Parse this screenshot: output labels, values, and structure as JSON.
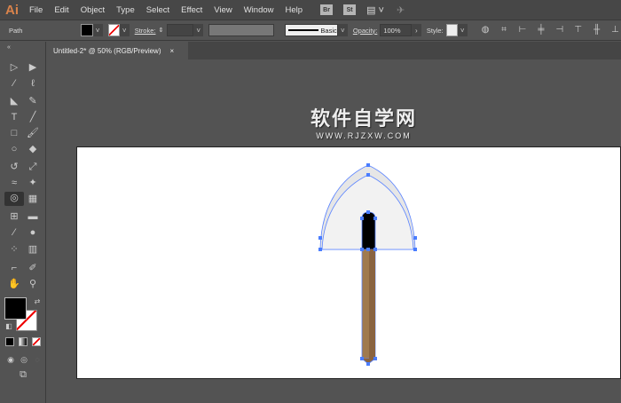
{
  "app": {
    "logo": "Ai"
  },
  "menu": [
    "File",
    "Edit",
    "Object",
    "Type",
    "Select",
    "Effect",
    "View",
    "Window",
    "Help"
  ],
  "bridge": [
    "Br",
    "St"
  ],
  "control": {
    "selection": "Path",
    "stroke_label": "Stroke:",
    "brush": "Basic",
    "opacity_label": "Opacity:",
    "opacity": "100%",
    "style_label": "Style:"
  },
  "document": {
    "tab": "Untitled-2* @ 50% (RGB/Preview)",
    "close": "×"
  },
  "watermark": {
    "title": "软件自学网",
    "url": "WWW.RJZXW.COM"
  },
  "colors": {
    "fill": "#000000",
    "stroke": "none",
    "shovel_blade": "#f2f2f2",
    "handle": "#9a7048",
    "selection": "#4a7dff"
  }
}
